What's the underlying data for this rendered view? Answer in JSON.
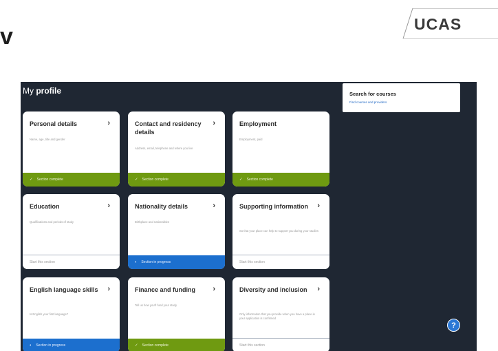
{
  "slide": {
    "title": "v"
  },
  "logo": {
    "text": "UCAS"
  },
  "header": {
    "title_prefix": "My",
    "title_strong": "profile"
  },
  "search": {
    "title": "Search for courses",
    "link": "Find courses and providers"
  },
  "cards": [
    {
      "title": "Personal details",
      "arrow": "›",
      "desc": "Name, age, title and gender",
      "status": {
        "type": "complete",
        "icon": "✓",
        "label": "Section complete"
      }
    },
    {
      "title": "Contact and residency details",
      "arrow": "›",
      "desc": "Address, email, telephone and where you live",
      "status": {
        "type": "complete",
        "icon": "✓",
        "label": "Section complete"
      }
    },
    {
      "title": "Employment",
      "arrow": "",
      "desc": "Employment, paid",
      "status": {
        "type": "complete",
        "icon": "✓",
        "label": "Section complete"
      }
    },
    {
      "title": "Education",
      "arrow": "›",
      "desc": "Qualifications and periods of study",
      "status": {
        "type": "start",
        "icon": "",
        "label": "Start this section"
      }
    },
    {
      "title": "Nationality details",
      "arrow": "›",
      "desc": "Birthplace and nationalities",
      "status": {
        "type": "progress",
        "icon": "◐",
        "label": "Section in progress"
      }
    },
    {
      "title": "Supporting information",
      "arrow": "›",
      "desc": "So that your place can help to support you during your studies",
      "status": {
        "type": "start",
        "icon": "",
        "label": "Start this section"
      }
    },
    {
      "title": "English language skills",
      "arrow": "›",
      "desc": "Is English your first language?",
      "status": {
        "type": "progress",
        "icon": "◐",
        "label": "Section in progress"
      }
    },
    {
      "title": "Finance and funding",
      "arrow": "›",
      "desc": "Tell us how you'll fund your study",
      "status": {
        "type": "complete",
        "icon": "✓",
        "label": "Section complete"
      }
    },
    {
      "title": "Diversity and inclusion",
      "arrow": "›",
      "desc": "Only information that you provide when you have a place in your application is confirmed",
      "status": {
        "type": "start",
        "icon": "",
        "label": "Start this section"
      }
    }
  ],
  "help": {
    "icon": "?"
  }
}
